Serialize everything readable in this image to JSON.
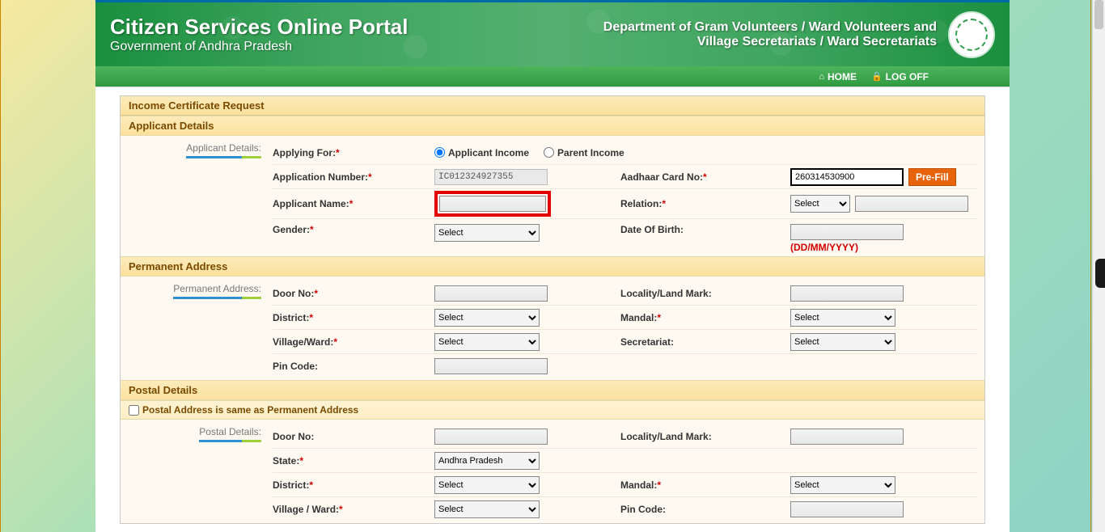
{
  "header": {
    "title": "Citizen Services Online Portal",
    "subtitle": "Government of Andhra Pradesh",
    "dept_line1": "Department of Gram Volunteers / Ward Volunteers and",
    "dept_line2": "Village Secretariats / Ward Secretariats"
  },
  "nav": {
    "home": "HOME",
    "logoff": "LOG OFF"
  },
  "page_title": "Income Certificate Request",
  "sections": {
    "applicant": {
      "title": "Applicant Details",
      "side_label": "Applicant Details:",
      "applying_for_label": "Applying For:",
      "radio1": "Applicant Income",
      "radio2": "Parent Income",
      "application_no_label": "Application Number:",
      "application_no_value": "IC012324927355",
      "aadhaar_label": "Aadhaar Card No:",
      "aadhaar_value": "260314530900",
      "prefill": "Pre-Fill",
      "applicant_name_label": "Applicant Name:",
      "relation_label": "Relation:",
      "relation_option": "Select",
      "gender_label": "Gender:",
      "gender_option": "Select",
      "dob_label": "Date Of Birth:",
      "dob_hint": "(DD/MM/YYYY)"
    },
    "permanent": {
      "title": "Permanent Address",
      "side_label": "Permanent Address:",
      "door_label": "Door No:",
      "locality_label": "Locality/Land Mark:",
      "district_label": "District:",
      "district_option": "Select",
      "mandal_label": "Mandal:",
      "mandal_option": "Select",
      "village_label": "Village/Ward:",
      "village_option": "Select",
      "secretariat_label": "Secretariat:",
      "secretariat_option": "Select",
      "pin_label": "Pin Code:"
    },
    "postal": {
      "title": "Postal Details",
      "same_as_label": "Postal Address is same as Permanent Address",
      "side_label": "Postal Details:",
      "door_label": "Door No:",
      "locality_label": "Locality/Land Mark:",
      "state_label": "State:",
      "state_option": "Andhra Pradesh",
      "district_label": "District:",
      "district_option": "Select",
      "mandal_label": "Mandal:",
      "mandal_option": "Select",
      "village_label": "Village / Ward:",
      "village_option": "Select",
      "pin_label": "Pin Code:"
    }
  }
}
